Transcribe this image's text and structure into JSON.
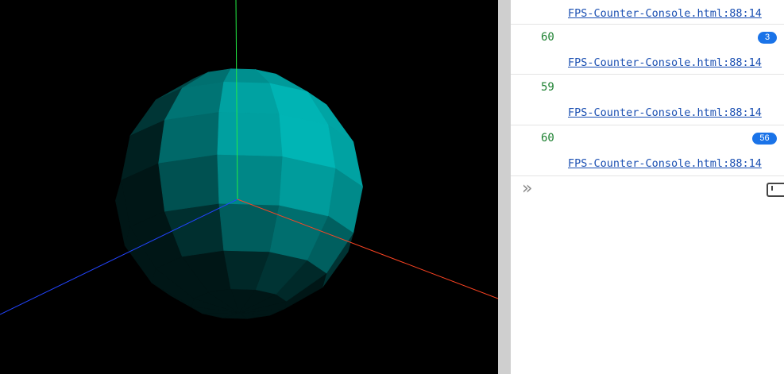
{
  "scene": {
    "description_object": "sphere",
    "sphere_color": "#00b4b4",
    "background": "#000000",
    "axes": {
      "x_color": "#ff4422",
      "y_color": "#22ee44",
      "z_color": "#2244ff"
    }
  },
  "console": {
    "rows": [
      {
        "value": "",
        "source": "FPS-Counter-Console.html:88:14",
        "badge": ""
      },
      {
        "value": "60",
        "source": "FPS-Counter-Console.html:88:14",
        "badge": "3"
      },
      {
        "value": "59",
        "source": "FPS-Counter-Console.html:88:14",
        "badge": ""
      },
      {
        "value": "60",
        "source": "FPS-Counter-Console.html:88:14",
        "badge": "56"
      }
    ],
    "prompt_icon": "double-chevron-right-icon",
    "sidebar_icon": "sidebar-toggle-icon"
  }
}
